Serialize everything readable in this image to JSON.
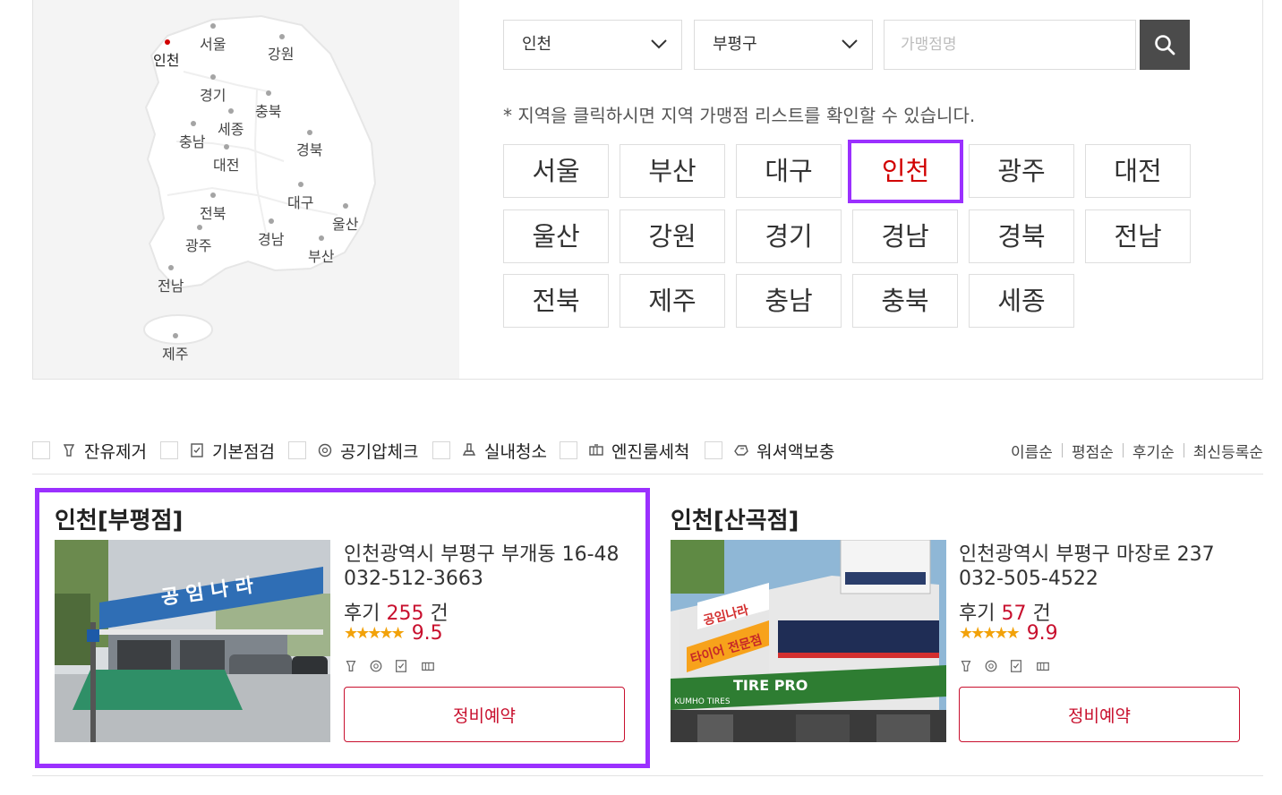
{
  "map": {
    "regions": [
      {
        "name": "인천",
        "active": true
      },
      {
        "name": "서울"
      },
      {
        "name": "강원"
      },
      {
        "name": "경기"
      },
      {
        "name": "충북"
      },
      {
        "name": "세종"
      },
      {
        "name": "충남"
      },
      {
        "name": "경북"
      },
      {
        "name": "대전"
      },
      {
        "name": "대구"
      },
      {
        "name": "전북"
      },
      {
        "name": "울산"
      },
      {
        "name": "광주"
      },
      {
        "name": "경남"
      },
      {
        "name": "부산"
      },
      {
        "name": "전남"
      },
      {
        "name": "제주"
      }
    ]
  },
  "search": {
    "city_select": "인천",
    "district_select": "부평구",
    "store_placeholder": "가맹점명",
    "button_icon": "search-icon"
  },
  "notice": "* 지역을 클릭하시면 지역 가맹점 리스트를 확인할 수 있습니다.",
  "region_buttons": [
    {
      "label": "서울"
    },
    {
      "label": "부산"
    },
    {
      "label": "대구"
    },
    {
      "label": "인천",
      "active": true
    },
    {
      "label": "광주"
    },
    {
      "label": "대전"
    },
    {
      "label": "울산"
    },
    {
      "label": "강원"
    },
    {
      "label": "경기"
    },
    {
      "label": "경남"
    },
    {
      "label": "경북"
    },
    {
      "label": "전남"
    },
    {
      "label": "전북"
    },
    {
      "label": "제주"
    },
    {
      "label": "충남"
    },
    {
      "label": "충북"
    },
    {
      "label": "세종"
    }
  ],
  "services": [
    {
      "label": "잔유제거",
      "icon": "oil-drop-icon"
    },
    {
      "label": "기본점검",
      "icon": "checklist-icon"
    },
    {
      "label": "공기압체크",
      "icon": "gauge-icon"
    },
    {
      "label": "실내청소",
      "icon": "vacuum-icon"
    },
    {
      "label": "엔진룸세척",
      "icon": "engine-icon"
    },
    {
      "label": "워셔액보충",
      "icon": "washer-icon"
    }
  ],
  "sort": [
    "이름순",
    "평점순",
    "후기순",
    "최신등록순"
  ],
  "shops": [
    {
      "title": "인천[부평점]",
      "address": "인천광역시 부평구 부개동 16-48",
      "phone": "032-512-3663",
      "review_prefix": "후기",
      "review_count": "255",
      "review_suffix": "건",
      "stars": "★★★★★",
      "score": "9.5",
      "button": "정비예약",
      "photo_sign": "공 임 나 라",
      "highlighted": true
    },
    {
      "title": "인천[산곡점]",
      "address": "인천광역시 부평구 마장로 237",
      "phone": "032-505-4522",
      "review_prefix": "후기",
      "review_count": "57",
      "review_suffix": "건",
      "stars": "★★★★★",
      "score": "9.9",
      "button": "정비예약",
      "photo_sign": "공임나라",
      "photo_sign2": "타이어 전문점",
      "photo_sign3": "TIRE PRO",
      "photo_sign4": "KUMHO TIRES",
      "highlighted": false
    }
  ],
  "colors": {
    "accent": "#c8102e",
    "highlight": "#9b30ff",
    "active_region": "#d10000",
    "search_button": "#4b4b4b"
  }
}
